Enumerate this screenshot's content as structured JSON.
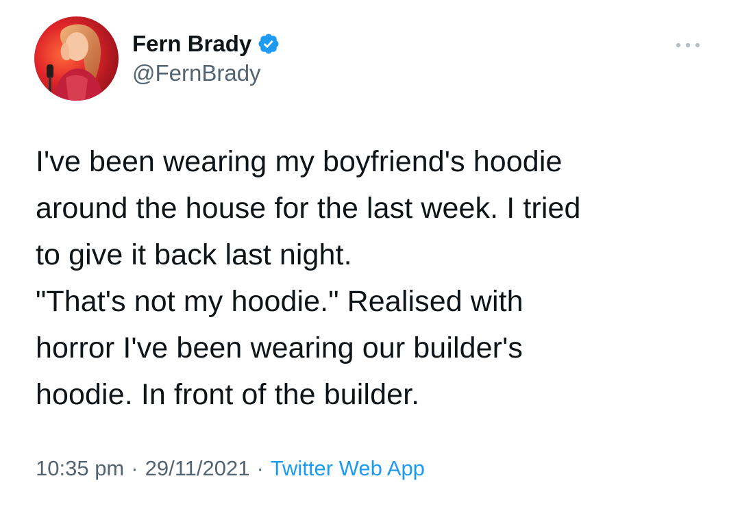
{
  "author": {
    "display_name": "Fern Brady",
    "handle": "@FernBrady",
    "verified": true,
    "verified_color": "#1d9bf0"
  },
  "tweet": {
    "lines": [
      "I've been wearing my boyfriend's hoodie",
      "around the house for the last week. I tried",
      "to give it back last night.",
      "\"That's not my hoodie.\" Realised with",
      "horror I've been wearing our builder's",
      "hoodie. In front of the builder."
    ]
  },
  "meta": {
    "time": "10:35 pm",
    "separator": "·",
    "date": "29/11/2021",
    "source": "Twitter Web App"
  },
  "icons": {
    "more": "more-dots-icon",
    "verified": "verified-badge-icon",
    "avatar": "profile-photo"
  },
  "colors": {
    "text": "#0f1419",
    "secondary": "#536471",
    "link": "#1d9bf0",
    "background": "#ffffff"
  }
}
